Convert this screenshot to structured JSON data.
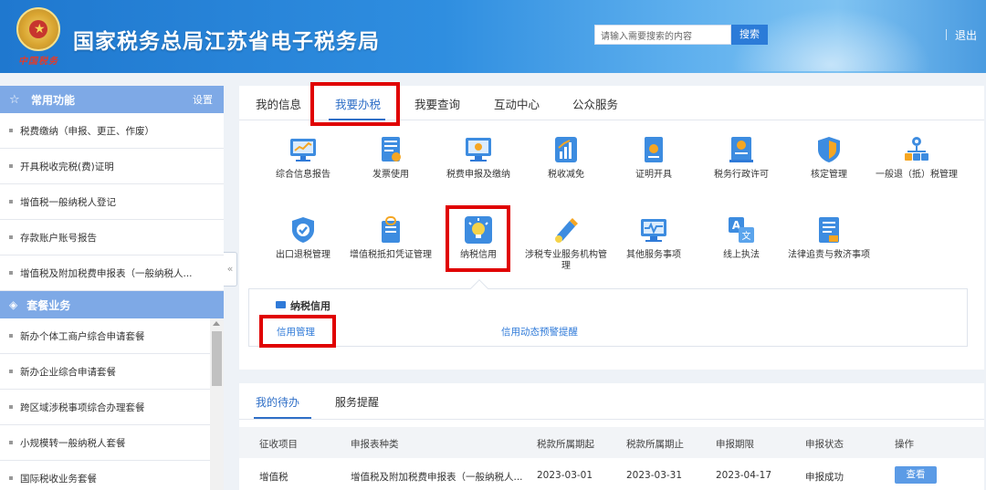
{
  "header": {
    "brand_sub": "中国税务",
    "title": "国家税务总局江苏省电子税务局",
    "search_placeholder": "请输入需要搜索的内容",
    "search_button": "搜索",
    "exit": "退出"
  },
  "sidebar": {
    "common_title": "常用功能",
    "settings": "设置",
    "common_items": [
      "税费缴纳（申报、更正、作废）",
      "开具税收完税(费)证明",
      "增值税一般纳税人登记",
      "存款账户账号报告",
      "增值税及附加税费申报表（一般纳税人..."
    ],
    "package_title": "套餐业务",
    "package_items": [
      "新办个体工商户综合申请套餐",
      "新办企业综合申请套餐",
      "跨区域涉税事项综合办理套餐",
      "小规模转一般纳税人套餐",
      "国际税收业务套餐"
    ]
  },
  "main": {
    "tabs": [
      "我的信息",
      "我要办税",
      "我要查询",
      "互动中心",
      "公众服务"
    ],
    "active_tab": "我要办税",
    "icons_row1": [
      {
        "label": "综合信息报告",
        "icon": "monitor-chart-icon"
      },
      {
        "label": "发票使用",
        "icon": "invoice-icon"
      },
      {
        "label": "税费申报及缴纳",
        "icon": "screen-icon"
      },
      {
        "label": "税收减免",
        "icon": "bar-chart-icon"
      },
      {
        "label": "证明开具",
        "icon": "certificate-icon"
      },
      {
        "label": "税务行政许可",
        "icon": "document-seal-icon"
      },
      {
        "label": "核定管理",
        "icon": "shield-icon"
      },
      {
        "label": "一般退（抵）税管理",
        "icon": "org-chart-icon"
      }
    ],
    "icons_row2": [
      {
        "label": "出口退税管理",
        "icon": "shield-check-icon"
      },
      {
        "label": "增值税抵扣凭证管理",
        "icon": "file-lock-icon"
      },
      {
        "label": "纳税信用",
        "icon": "lightbulb-icon"
      },
      {
        "label": "涉税专业服务机构管理",
        "icon": "pen-icon"
      },
      {
        "label": "其他服务事项",
        "icon": "pulse-monitor-icon"
      },
      {
        "label": "线上执法",
        "icon": "translate-icon"
      },
      {
        "label": "法律追责与救济事项",
        "icon": "checklist-icon"
      }
    ],
    "sub_title": "纳税信用",
    "sub_links": [
      "信用管理",
      "信用动态预警提醒"
    ]
  },
  "todo": {
    "tabs": [
      "我的待办",
      "服务提醒"
    ],
    "columns": [
      "征收项目",
      "申报表种类",
      "税款所属期起",
      "税款所属期止",
      "申报期限",
      "申报状态",
      "操作"
    ],
    "rows": [
      [
        "增值税",
        "增值税及附加税费申报表（一般纳税人...",
        "2023-03-01",
        "2023-03-31",
        "2023-04-17",
        "申报成功",
        "查看"
      ]
    ]
  }
}
